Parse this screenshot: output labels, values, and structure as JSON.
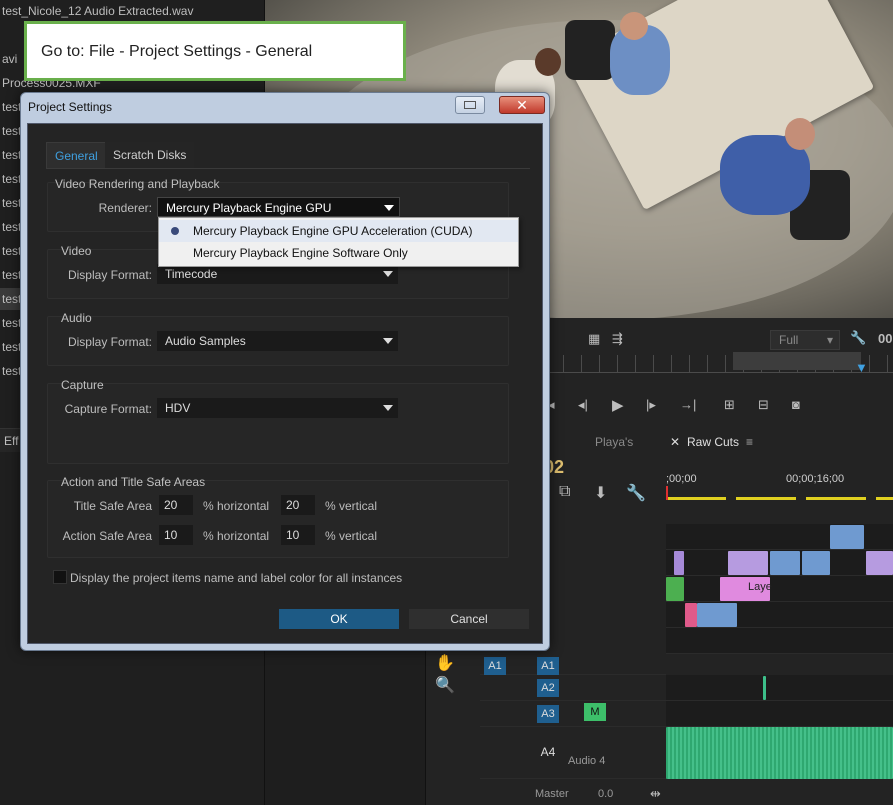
{
  "callout": {
    "text": "Go to: File - Project Settings - General"
  },
  "left_panel": {
    "files": [
      "test_Nicole_12 Audio Extracted.wav",
      "avi",
      "Process0025.MXF",
      "test",
      "test",
      "test",
      "test",
      "test",
      "test",
      "test",
      "test",
      "test",
      "test",
      "test",
      "test",
      "test"
    ],
    "effects_tab": "Eff"
  },
  "monitor": {
    "zoom": "Full",
    "timecode_fragment": "00"
  },
  "timeline": {
    "tabs": [
      "Playa's",
      "Raw Cuts"
    ],
    "timecode": ";02",
    "ruler_labels": [
      ";00;00",
      "00;00;16;00"
    ],
    "tracks": [
      {
        "label": "A1",
        "source": "A1"
      },
      {
        "label": "A2"
      },
      {
        "label": "A3",
        "mute": "M"
      },
      {
        "label": "A4",
        "name": "Audio 4"
      }
    ],
    "master": {
      "label": "Master",
      "value": "0.0"
    },
    "clip_label": "Laye"
  },
  "dialog": {
    "title": "Project Settings",
    "close_glyph": "✕",
    "tabs": [
      "General",
      "Scratch Disks"
    ],
    "video_rendering": {
      "title": "Video Rendering and Playback",
      "renderer_label": "Renderer:",
      "renderer_value": "Mercury Playback Engine GPU Acceleration",
      "options": [
        "Mercury Playback Engine GPU Acceleration (CUDA)",
        "Mercury Playback Engine Software Only"
      ]
    },
    "video": {
      "title": "Video",
      "display_format_label": "Display Format:",
      "display_format_value": "Timecode"
    },
    "audio": {
      "title": "Audio",
      "display_format_label": "Display Format:",
      "display_format_value": "Audio Samples"
    },
    "capture": {
      "title": "Capture",
      "capture_format_label": "Capture Format:",
      "capture_format_value": "HDV"
    },
    "safe_areas": {
      "title": "Action and Title Safe Areas",
      "title_safe_label": "Title Safe Area",
      "title_h": "20",
      "title_v": "20",
      "action_safe_label": "Action Safe Area",
      "action_h": "10",
      "action_v": "10",
      "horizontal_unit": "% horizontal",
      "vertical_unit": "% vertical"
    },
    "checkbox_label": "Display the project items name and label color for all instances",
    "ok": "OK",
    "cancel": "Cancel"
  }
}
